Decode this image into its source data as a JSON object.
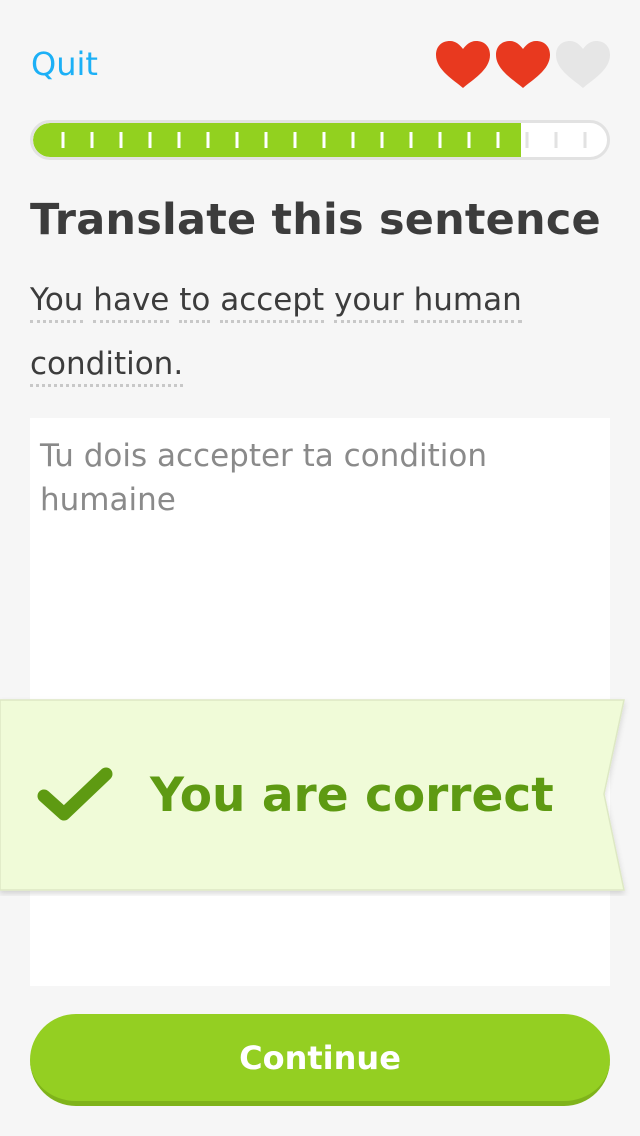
{
  "header": {
    "quit_label": "Quit",
    "hearts": [
      {
        "state": "full",
        "color": "#e8391f"
      },
      {
        "state": "full",
        "color": "#e8391f"
      },
      {
        "state": "empty",
        "color": "#e6e6e6"
      }
    ]
  },
  "progress": {
    "fraction": 0.85,
    "fill_color": "#92d11f"
  },
  "exercise": {
    "title": "Translate this sentence",
    "prompt_words": [
      "You",
      "have",
      "to",
      "accept",
      "your",
      "human",
      "condition."
    ],
    "answer_text": "Tu dois accepter ta condition humaine"
  },
  "feedback": {
    "icon": "checkmark-icon",
    "message": "You are correct",
    "accent_color": "#5e9a12"
  },
  "footer": {
    "continue_label": "Continue"
  }
}
